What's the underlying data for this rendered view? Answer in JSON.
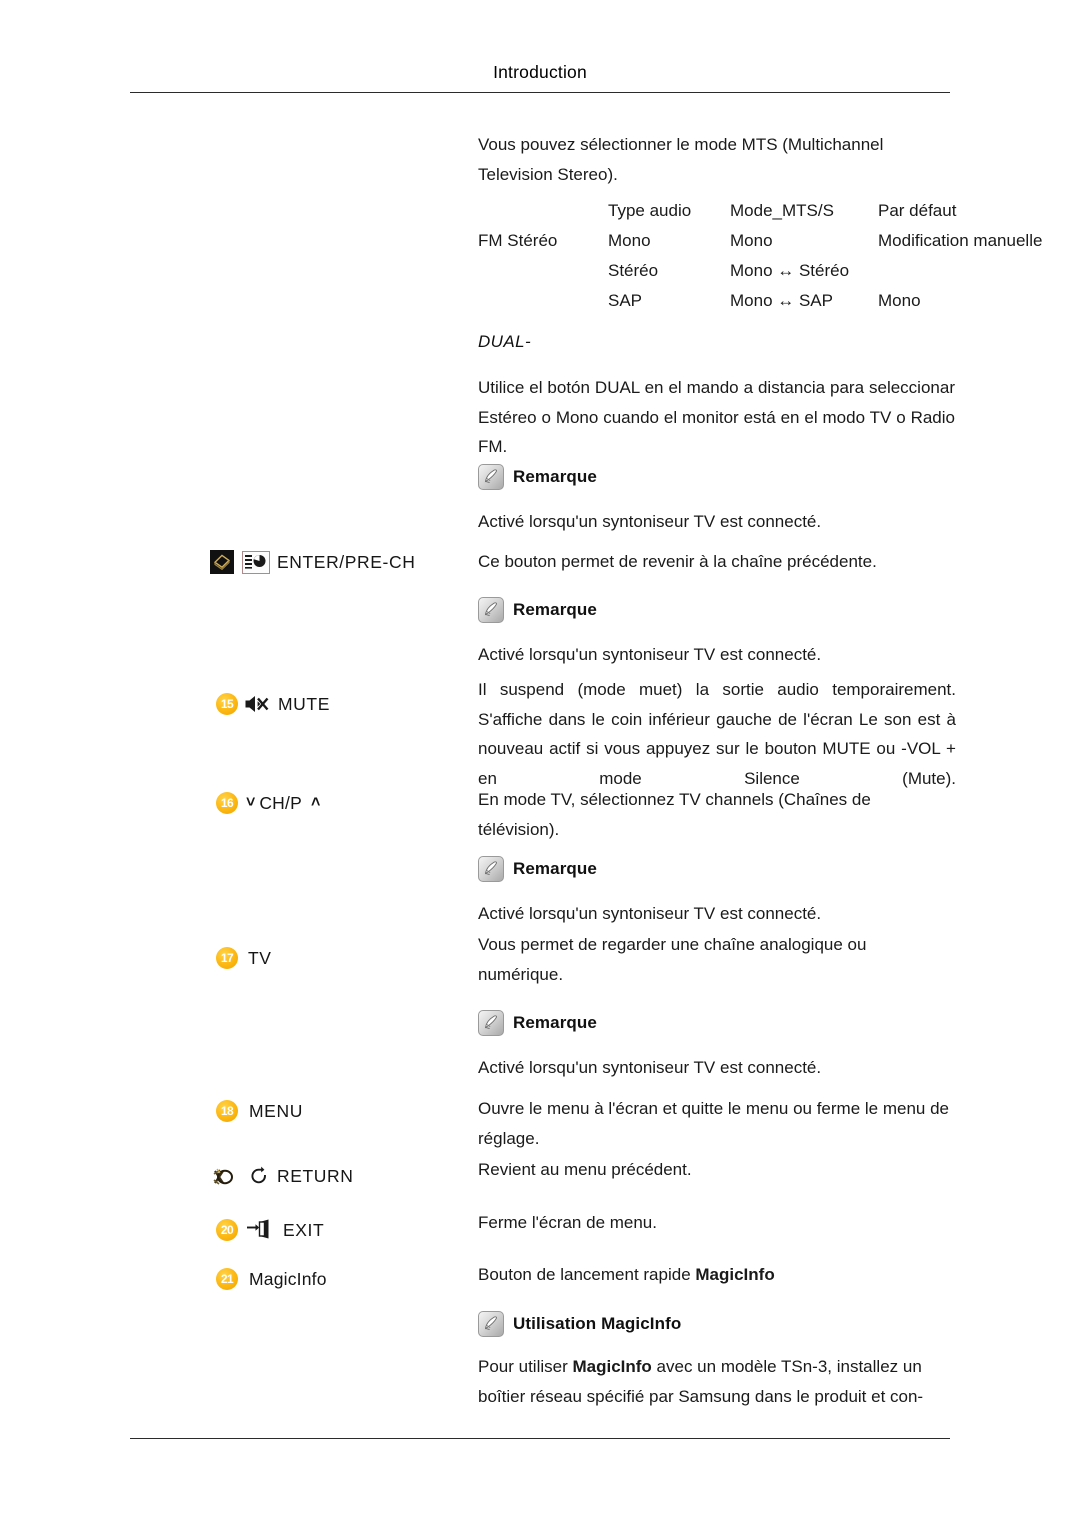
{
  "page": {
    "header_title": "Introduction"
  },
  "intro": {
    "mts_paragraph": "Vous pouvez sélectionner le mode MTS (Multichannel Television Stereo)."
  },
  "mts_table": {
    "columns": [
      "",
      "Type audio",
      "Mode_MTS/S",
      "Par défaut"
    ],
    "rows": [
      {
        "mode": "FM Stéréo",
        "type": "Mono",
        "mts": "Mono",
        "default": "Modification manuelle"
      },
      {
        "mode": "",
        "type": "Stéréo",
        "mts": "Mono ↔ Stéréo",
        "default": ""
      },
      {
        "mode": "",
        "type": "SAP",
        "mts": "Mono ↔ SAP",
        "default": "Mono"
      }
    ]
  },
  "dual": {
    "heading": "DUAL-",
    "body": "Utilice el botón DUAL en el mando a distancia para seleccionar Estéreo o Mono cuando el monitor está en el modo TV o Radio FM."
  },
  "notes": {
    "remarque_label": "Remarque",
    "tuner_text": "Activé lorsqu'un syntoniseur TV est connecté.",
    "magicinfo_label": "Utilisation MagicInfo"
  },
  "buttons": [
    {
      "num": "",
      "label": "ENTER/PRE-CH",
      "icons": [
        "enter-diamond-icon",
        "pre-ch-icon"
      ],
      "description": "Ce bouton permet de revenir à la chaîne précédente."
    },
    {
      "num": "15",
      "label": "MUTE",
      "icons": [
        "mute-speaker-icon"
      ],
      "description": "Il suspend (mode muet) la sortie audio temporairement. S'affiche dans le coin inférieur gauche de l'écran Le son est à nouveau actif si vous appuyez sur le bouton MUTE ou -VOL + en mode Silence (Mute)."
    },
    {
      "num": "16",
      "label": "CH/P",
      "prefix_glyph": "˅",
      "suffix_glyph": "˄",
      "icons": [
        "chevron-down-icon",
        "chevron-up-icon"
      ],
      "description": "En mode TV, sélectionnez TV channels (Chaînes de télévision)."
    },
    {
      "num": "17",
      "label": "TV",
      "icons": [],
      "description": "Vous permet de regarder une chaîne analogique ou numérique."
    },
    {
      "num": "18",
      "label": "MENU",
      "icons": [],
      "description": "Ouvre le menu à l'écran et quitte le menu ou ferme le menu de réglage."
    },
    {
      "num": "19",
      "label": "RETURN",
      "icons": [
        "return-arrow-icon"
      ],
      "description": "Revient au menu précédent."
    },
    {
      "num": "20",
      "label": "EXIT",
      "icons": [
        "exit-door-icon"
      ],
      "description": "Ferme l'écran de menu."
    },
    {
      "num": "21",
      "label": "MagicInfo",
      "icons": [],
      "description": "Bouton de lancement rapide MagicInfo"
    }
  ],
  "magicinfo": {
    "quick_launch_prefix": "Bouton de lancement rapide ",
    "quick_launch_bold": "MagicInfo",
    "usage_prefix": "Pour utiliser ",
    "usage_bold": "MagicInfo",
    "usage_suffix": " avec un modèle TSn-3, installez un boîtier réseau spécifié par Samsung dans le produit et con-"
  },
  "colors": {
    "badge": "#fcb813",
    "text": "#1a1a1a",
    "rule": "#2b2b2b",
    "note_icon": "#c9c9c9"
  }
}
